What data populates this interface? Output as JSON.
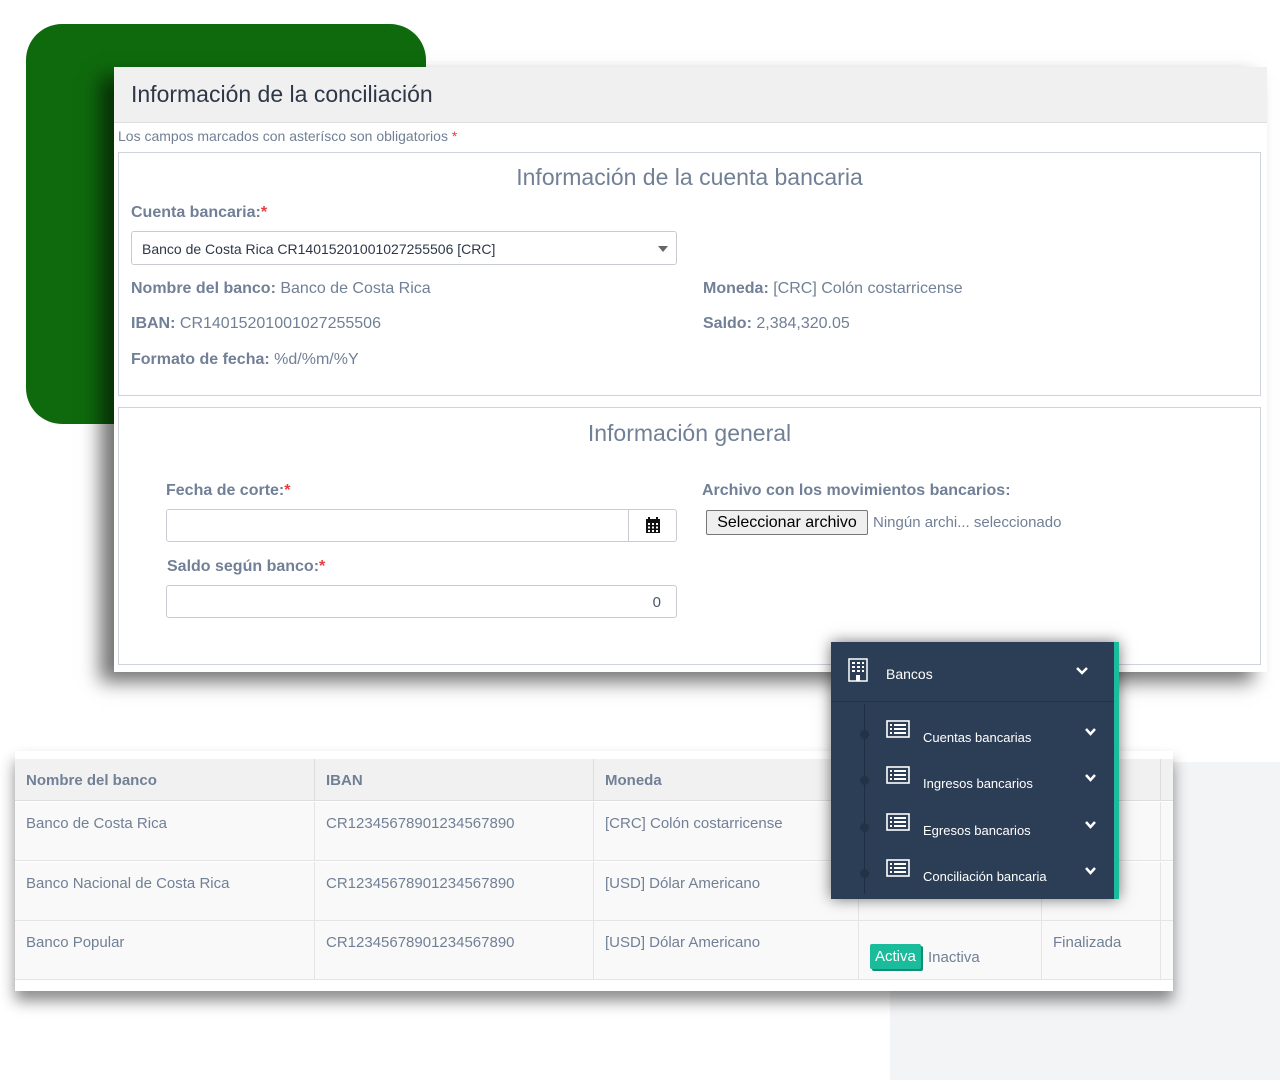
{
  "form": {
    "title": "Información de la conciliación",
    "required_note": "Los campos marcados con asterísco son obligatorios",
    "required_star": "*",
    "account_section": {
      "title": "Información de la cuenta bancaria",
      "account_label": "Cuenta bancaria:",
      "account_selected": "Banco de Costa Rica CR14015201001027255506 [CRC]",
      "bank_name_label": "Nombre del banco:",
      "bank_name_value": "Banco de Costa Rica",
      "currency_label": "Moneda:",
      "currency_value": "[CRC] Colón costarricense",
      "iban_label": "IBAN:",
      "iban_value": "CR14015201001027255506",
      "balance_label": "Saldo:",
      "balance_value": "2,384,320.05",
      "date_format_label": "Formato de fecha:",
      "date_format_value": "%d/%m/%Y"
    },
    "general_section": {
      "title": "Información general",
      "cutoff_date_label": "Fecha de corte:",
      "cutoff_date_value": "",
      "file_label": "Archivo con los movimientos bancarios:",
      "file_button": "Seleccionar archivo",
      "file_status": "Ningún archi... seleccionado",
      "bank_balance_label": "Saldo según banco:",
      "bank_balance_value": "0"
    }
  },
  "table": {
    "headers": [
      "Nombre del banco",
      "IBAN",
      "Moneda"
    ],
    "rows": [
      {
        "bank": "Banco de Costa Rica",
        "iban": "CR12345678901234567890",
        "currency": "[CRC] Colón costarricense"
      },
      {
        "bank": "Banco Nacional de Costa Rica",
        "iban": "CR12345678901234567890",
        "currency": "[USD] Dólar Americano"
      },
      {
        "bank": "Banco Popular",
        "iban": "CR12345678901234567890",
        "currency": "[USD] Dólar Americano",
        "status_active": "Activa",
        "status_inactive": "Inactiva",
        "state": "Finalizada"
      }
    ]
  },
  "menu": {
    "main_label": "Bancos",
    "items": [
      {
        "label": "Cuentas bancarias"
      },
      {
        "label": "Ingresos bancarios"
      },
      {
        "label": "Egresos bancarios"
      },
      {
        "label": "Conciliación bancaria"
      }
    ]
  },
  "colors": {
    "accent": "#1abc9c",
    "green_block": "#0f6a0d",
    "menu_bg": "#2c3e55",
    "required": "#e53e3e"
  }
}
